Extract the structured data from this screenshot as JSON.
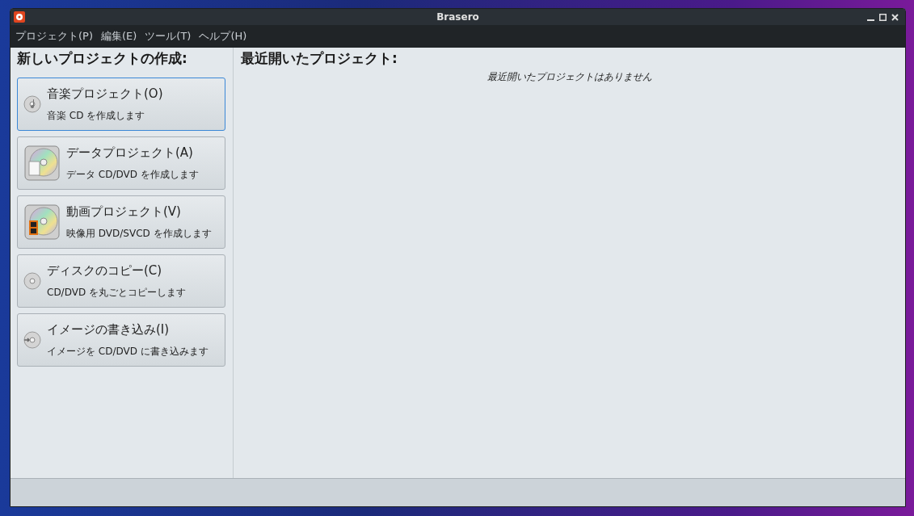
{
  "window": {
    "title": "Brasero"
  },
  "menu": [
    "プロジェクト(P)",
    "編集(E)",
    "ツール(T)",
    "ヘルプ(H)"
  ],
  "new_project": {
    "heading": "新しいプロジェクトの作成:",
    "items": [
      {
        "kind": "audio",
        "title": "音楽プロジェクト(O)",
        "description": "音楽 CD を作成します",
        "selected": true
      },
      {
        "kind": "data",
        "title": "データプロジェクト(A)",
        "description": "データ CD/DVD を作成します",
        "selected": false
      },
      {
        "kind": "video",
        "title": "動画プロジェクト(V)",
        "description": "映像用 DVD/SVCD を作成します",
        "selected": false
      },
      {
        "kind": "copy",
        "title": "ディスクのコピー(C)",
        "description": "CD/DVD を丸ごとコピーします",
        "selected": false
      },
      {
        "kind": "image",
        "title": "イメージの書き込み(I)",
        "description": "イメージを CD/DVD に書き込みます",
        "selected": false
      }
    ]
  },
  "recent": {
    "heading": "最近開いたプロジェクト:",
    "empty_message": "最近開いたプロジェクトはありません"
  }
}
